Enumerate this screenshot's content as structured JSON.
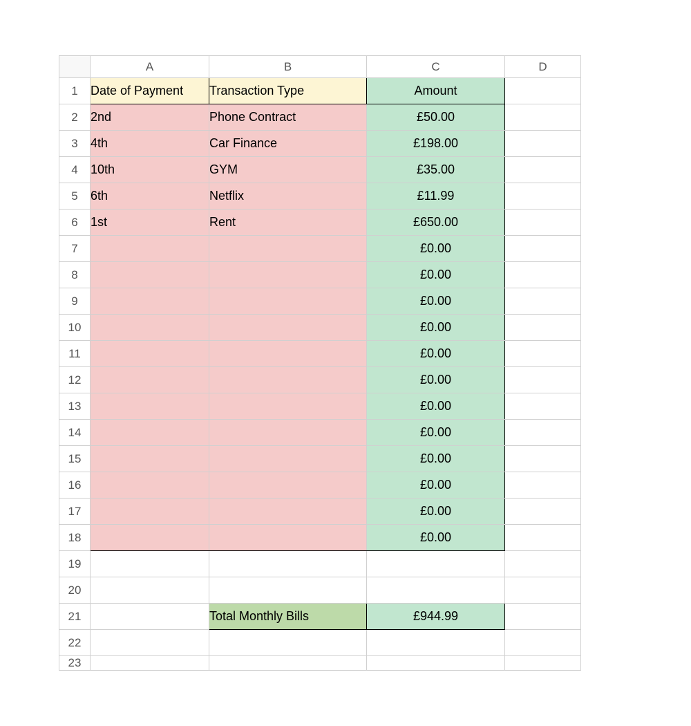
{
  "columns": [
    "A",
    "B",
    "C",
    "D"
  ],
  "row_numbers": [
    1,
    2,
    3,
    4,
    5,
    6,
    7,
    8,
    9,
    10,
    11,
    12,
    13,
    14,
    15,
    16,
    17,
    18,
    19,
    20,
    21,
    22,
    23
  ],
  "headers": {
    "date": "Date of Payment",
    "type": "Transaction Type",
    "amount": "Amount"
  },
  "rows": [
    {
      "date": "2nd",
      "type": "Phone Contract",
      "amount": "£50.00"
    },
    {
      "date": "4th",
      "type": "Car Finance",
      "amount": "£198.00"
    },
    {
      "date": "10th",
      "type": "GYM",
      "amount": "£35.00"
    },
    {
      "date": "6th",
      "type": "Netflix",
      "amount": "£11.99"
    },
    {
      "date": "1st",
      "type": "Rent",
      "amount": "£650.00"
    },
    {
      "date": "",
      "type": "",
      "amount": "£0.00"
    },
    {
      "date": "",
      "type": "",
      "amount": "£0.00"
    },
    {
      "date": "",
      "type": "",
      "amount": "£0.00"
    },
    {
      "date": "",
      "type": "",
      "amount": "£0.00"
    },
    {
      "date": "",
      "type": "",
      "amount": "£0.00"
    },
    {
      "date": "",
      "type": "",
      "amount": "£0.00"
    },
    {
      "date": "",
      "type": "",
      "amount": "£0.00"
    },
    {
      "date": "",
      "type": "",
      "amount": "£0.00"
    },
    {
      "date": "",
      "type": "",
      "amount": "£0.00"
    },
    {
      "date": "",
      "type": "",
      "amount": "£0.00"
    },
    {
      "date": "",
      "type": "",
      "amount": "£0.00"
    },
    {
      "date": "",
      "type": "",
      "amount": "£0.00"
    }
  ],
  "total": {
    "label": "Total Monthly Bills",
    "amount": "£944.99"
  },
  "chart_data": {
    "type": "table",
    "title": "Monthly Bills",
    "columns": [
      "Date of Payment",
      "Transaction Type",
      "Amount"
    ],
    "rows": [
      [
        "2nd",
        "Phone Contract",
        50.0
      ],
      [
        "4th",
        "Car Finance",
        198.0
      ],
      [
        "10th",
        "GYM",
        35.0
      ],
      [
        "6th",
        "Netflix",
        11.99
      ],
      [
        "1st",
        "Rent",
        650.0
      ]
    ],
    "total": 944.99,
    "currency": "GBP"
  }
}
